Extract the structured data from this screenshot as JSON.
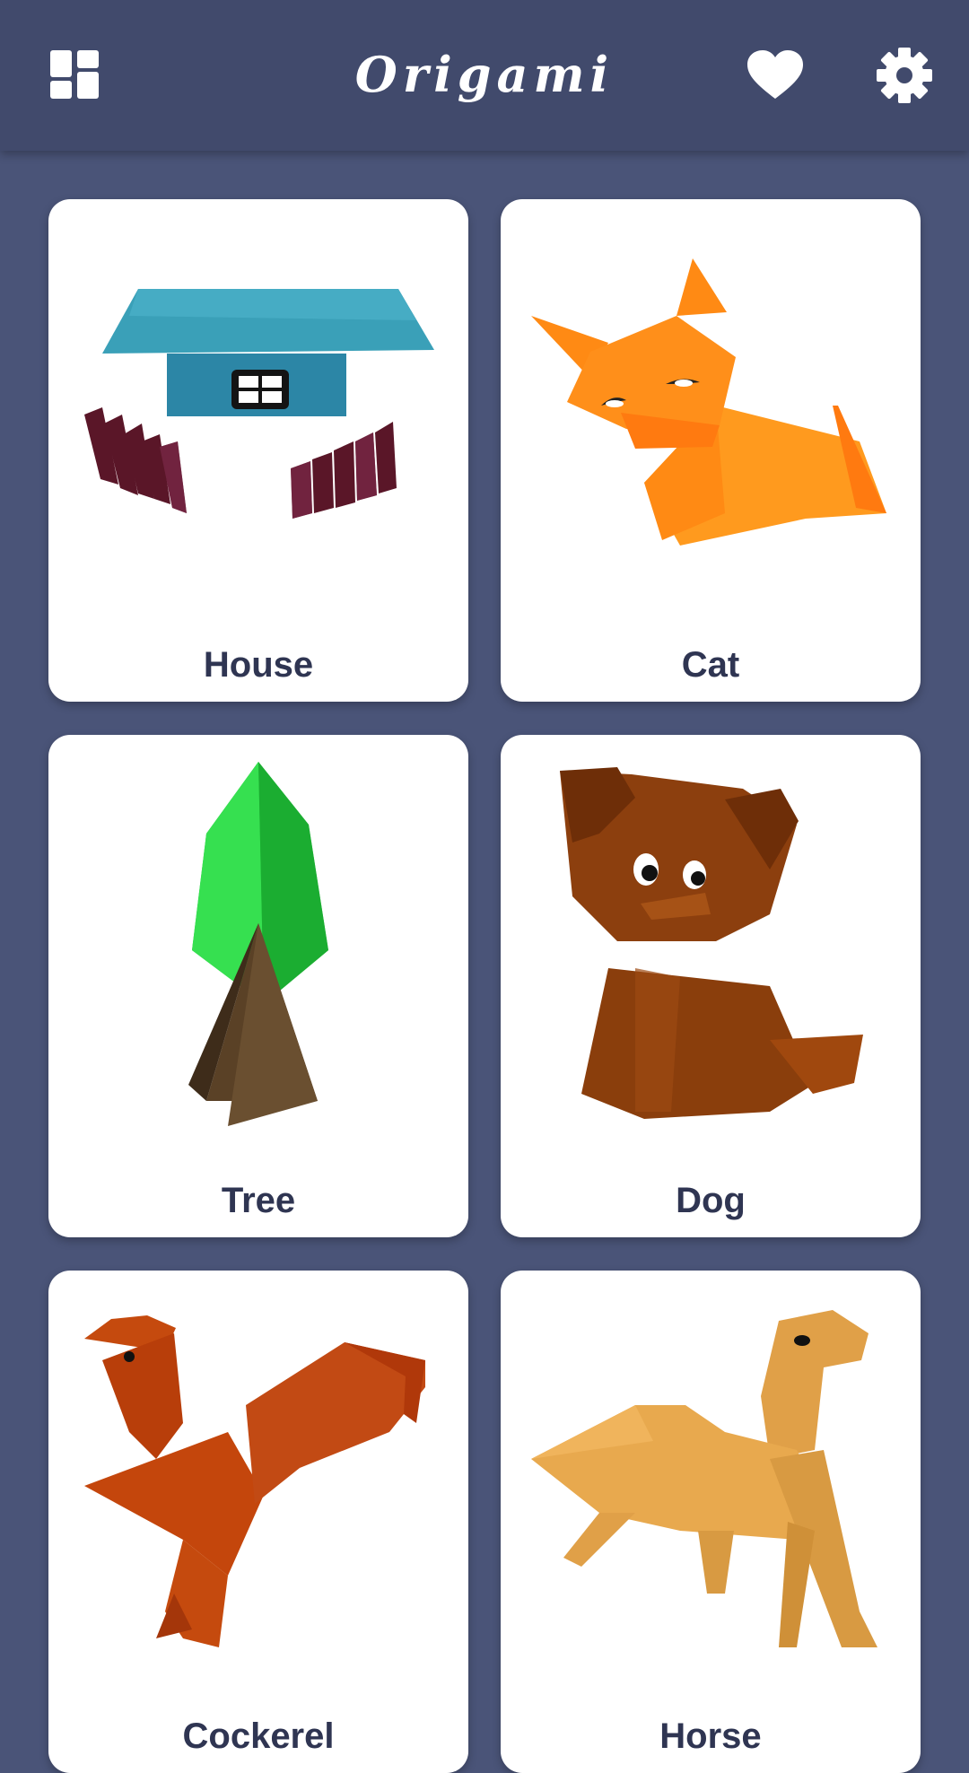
{
  "app": {
    "title": "Origami",
    "icons": {
      "left": "dashboard-icon",
      "favorites": "heart-icon",
      "settings": "gear-icon"
    },
    "colors": {
      "appbar": "#414a6c",
      "background": "#4a5478",
      "card": "#ffffff",
      "label": "#2f3552"
    }
  },
  "items": [
    {
      "label": "House"
    },
    {
      "label": "Cat"
    },
    {
      "label": "Tree"
    },
    {
      "label": "Dog"
    },
    {
      "label": "Cockerel"
    },
    {
      "label": "Horse"
    }
  ]
}
